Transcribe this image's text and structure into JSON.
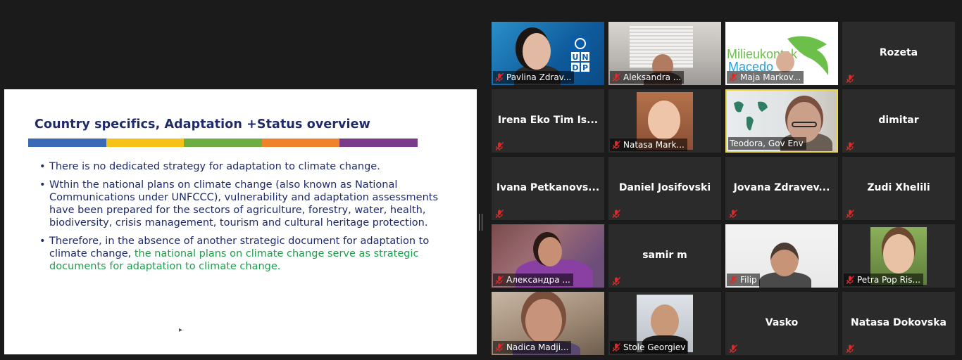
{
  "slide": {
    "title": "Country specifics, Adaptation +Status overview",
    "bar_colors": [
      "#3a6ab5",
      "#f6c21a",
      "#6cae41",
      "#f0832a",
      "#7b3b8d"
    ],
    "bullets": [
      {
        "text": "There is no dedicated strategy for adaptation to climate change.",
        "highlight": ""
      },
      {
        "text": "Wthin the national plans on climate change (also known as National Communications under UNFCCC), vulnerability and adaptation assessments have been prepared for the sectors of agriculture, forestry, water, health, biodiversity, crisis management, tourism and cultural heritage protection.",
        "highlight": ""
      },
      {
        "text": "Therefore, in the absence of another strategic document for adaptation to climate change, ",
        "highlight": "the national plans on climate change serve as strategic documents for adaptation to climate change."
      }
    ]
  },
  "participants": [
    {
      "name": "Pavlina Zdrav...",
      "video": "undp",
      "muted": true
    },
    {
      "name": "Aleksandra ...",
      "video": "window",
      "muted": true
    },
    {
      "name": "Maja Markov...",
      "video": "logo",
      "logo_text": [
        "Milieukontak",
        "Macedo"
      ],
      "muted": true
    },
    {
      "name": "Rozeta",
      "video": "none",
      "muted": true
    },
    {
      "name": "Irena Eko Tim Is...",
      "video": "none",
      "muted": true
    },
    {
      "name": "Natasa Mark...",
      "video": "portrait",
      "muted": true
    },
    {
      "name": "Teodora, Gov Env",
      "video": "teodora",
      "muted": false,
      "active": true
    },
    {
      "name": "dimitar",
      "video": "none",
      "muted": true
    },
    {
      "name": "Ivana  Petkanovs...",
      "video": "none",
      "muted": true
    },
    {
      "name": "Daniel Josifovski",
      "video": "none",
      "muted": true
    },
    {
      "name": "Jovana  Zdravev...",
      "video": "none",
      "muted": true
    },
    {
      "name": "Zudi Xhelili",
      "video": "none",
      "muted": true
    },
    {
      "name": "Александра ...",
      "video": "purple",
      "muted": true
    },
    {
      "name": "samir m",
      "video": "none",
      "muted": true
    },
    {
      "name": "Filip",
      "video": "filip",
      "muted": true
    },
    {
      "name": "Petra Pop Ris...",
      "video": "petra",
      "muted": true
    },
    {
      "name": "Nadica Madji...",
      "video": "nadica",
      "muted": true
    },
    {
      "name": "Stole Georgiev",
      "video": "stole",
      "muted": true
    },
    {
      "name": "Vasko",
      "video": "none",
      "muted": true
    },
    {
      "name": "Natasa Dokovska",
      "video": "none",
      "muted": true
    }
  ],
  "icons": {
    "mic": "mic-off-icon",
    "cursor": "mouse-cursor-icon"
  },
  "colors": {
    "mic_off": "#e02828",
    "active_speaker": "#ecd94a",
    "tile_bg": "#2b2b2b",
    "slide_text": "#1f2a6b",
    "slide_highlight": "#1e9e4b"
  }
}
